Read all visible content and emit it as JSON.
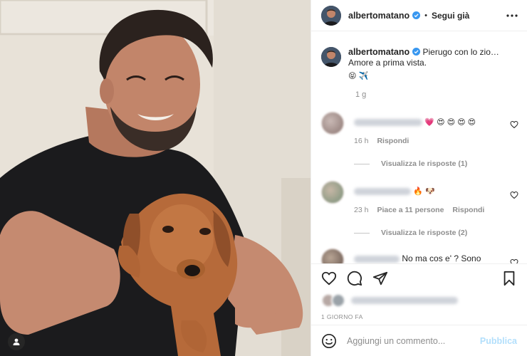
{
  "post": {
    "username": "albertomatano",
    "follow_label": "Segui già",
    "separator": "•",
    "caption": {
      "line1": "Pierugo con lo zio…",
      "line2": "Amore a prima vista.",
      "emojis": "😝 ✈️",
      "time": "1 g"
    },
    "comments": [
      {
        "text_suffix": "💗 😍 😍 😍 😍",
        "time": "16 h",
        "likes": "",
        "reply_label": "Rispondi",
        "view_replies": "Visualizza le risposte (1)"
      },
      {
        "text_suffix": "🔥 🐶",
        "time": "23 h",
        "likes": "Piace a 11 persone",
        "reply_label": "Rispondi",
        "view_replies": "Visualizza le risposte (2)"
      },
      {
        "text_suffix": "No ma cos e' ? Sono",
        "time": "",
        "likes": "",
        "reply_label": "",
        "view_replies": ""
      }
    ],
    "date": "1 GIORNO FA",
    "add_comment_placeholder": "Aggiungi un commento...",
    "publish_label": "Pubblica"
  },
  "icons": {
    "like": "heart-icon",
    "comment": "comment-icon",
    "share": "send-icon",
    "save": "bookmark-icon",
    "more": "more-horizontal-icon",
    "emoji": "emoji-icon",
    "verified": "verified-badge-icon",
    "tag": "user-tag-icon"
  },
  "colors": {
    "verified": "#3897f0",
    "publish_disabled": "#b2dffc",
    "secondary_text": "#8e8e8e"
  }
}
